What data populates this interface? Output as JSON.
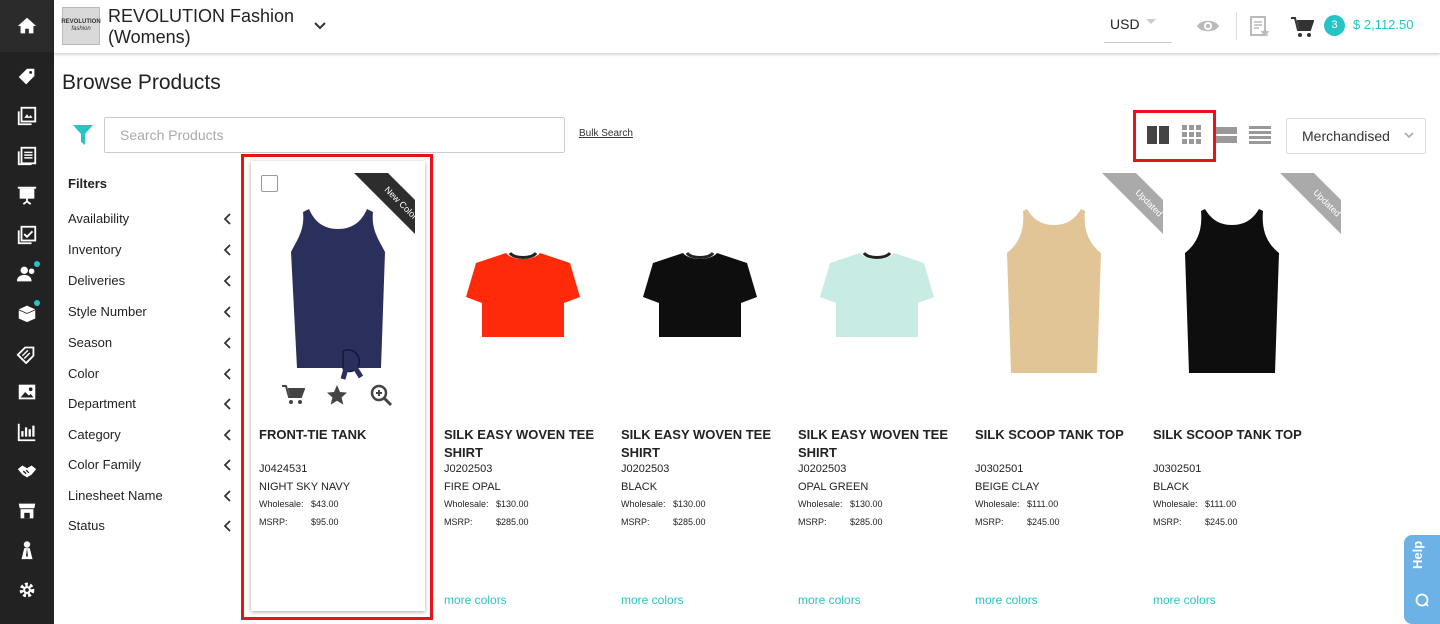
{
  "brand": {
    "logo_line1": "REVOLUTION",
    "logo_line2": "fashion",
    "name": "REVOLUTION Fashion (Womens)"
  },
  "topbar": {
    "currency": "USD",
    "cart_count": "3",
    "cart_total": "$ 2,112.50"
  },
  "page": {
    "title": "Browse Products"
  },
  "search": {
    "placeholder": "Search Products",
    "value": "",
    "bulk_label": "Bulk Search"
  },
  "sort": {
    "selected": "Merchandised"
  },
  "filters": {
    "title": "Filters",
    "items": [
      "Availability",
      "Inventory",
      "Deliveries",
      "Style Number",
      "Season",
      "Color",
      "Department",
      "Category",
      "Color Family",
      "Linesheet Name",
      "Status"
    ]
  },
  "labels": {
    "wholesale": "Wholesale:",
    "msrp": "MSRP:",
    "more_colors": "more colors"
  },
  "products": [
    {
      "name": "FRONT-TIE TANK",
      "sku": "J0424531",
      "color": "NIGHT SKY NAVY",
      "wholesale": "$43.00",
      "msrp": "$95.00",
      "ribbon": "New Color",
      "garment_color": "#2b2f5c"
    },
    {
      "name": "SILK EASY WOVEN TEE SHIRT",
      "sku": "J0202503",
      "color": "FIRE OPAL",
      "wholesale": "$130.00",
      "msrp": "$285.00",
      "ribbon": "",
      "garment_color": "#ff2a0a"
    },
    {
      "name": "SILK EASY WOVEN TEE SHIRT",
      "sku": "J0202503",
      "color": "BLACK",
      "wholesale": "$130.00",
      "msrp": "$285.00",
      "ribbon": "",
      "garment_color": "#0e0e0e"
    },
    {
      "name": "SILK EASY WOVEN TEE SHIRT",
      "sku": "J0202503",
      "color": "OPAL GREEN",
      "wholesale": "$130.00",
      "msrp": "$285.00",
      "ribbon": "",
      "garment_color": "#c8ece4"
    },
    {
      "name": "SILK SCOOP TANK TOP",
      "sku": "J0302501",
      "color": "BEIGE CLAY",
      "wholesale": "$111.00",
      "msrp": "$245.00",
      "ribbon": "Updated",
      "garment_color": "#e2c596"
    },
    {
      "name": "SILK SCOOP TANK TOP",
      "sku": "J0302501",
      "color": "BLACK",
      "wholesale": "$111.00",
      "msrp": "$245.00",
      "ribbon": "Updated",
      "garment_color": "#0e0e0e"
    }
  ],
  "help": {
    "label": "Help"
  },
  "colors": {
    "accent": "#27c4c6",
    "highlight": "#e8121a",
    "sidebar": "#222222"
  }
}
